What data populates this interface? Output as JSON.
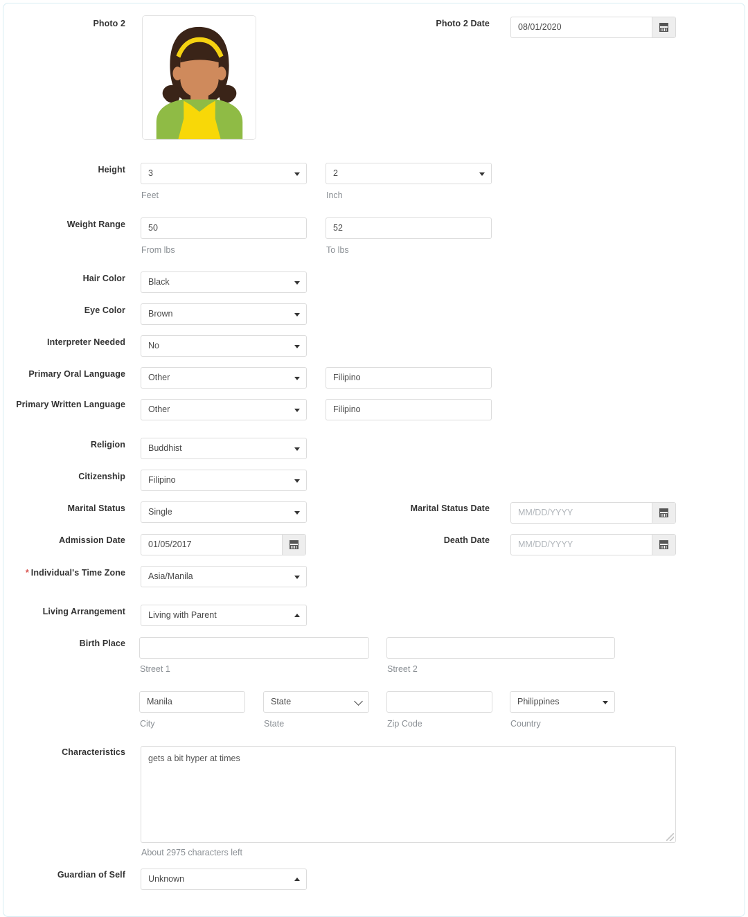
{
  "form": {
    "photo": {
      "label": "Photo 2",
      "alt": "girl-avatar",
      "date_label": "Photo 2 Date",
      "date_value": "08/01/2020",
      "colors": {
        "hair": "#3a2418",
        "headband": "#f5d211",
        "skin": "#cf8a5c",
        "shirt": "#8fbb45",
        "overalls": "#f8d808"
      }
    },
    "height": {
      "label": "Height",
      "feet_value": "3",
      "feet_helper": "Feet",
      "inch_value": "2",
      "inch_helper": "Inch"
    },
    "weight": {
      "label": "Weight Range",
      "from_value": "50",
      "from_helper": "From lbs",
      "to_value": "52",
      "to_helper": "To lbs"
    },
    "hair_color": {
      "label": "Hair Color",
      "value": "Black"
    },
    "eye_color": {
      "label": "Eye Color",
      "value": "Brown"
    },
    "interpreter": {
      "label": "Interpreter Needed",
      "value": "No"
    },
    "oral_language": {
      "label": "Primary Oral Language",
      "value": "Other",
      "other_value": "Filipino"
    },
    "written_language": {
      "label": "Primary Written Language",
      "value": "Other",
      "other_value": "Filipino"
    },
    "religion": {
      "label": "Religion",
      "value": "Buddhist"
    },
    "citizenship": {
      "label": "Citizenship",
      "value": "Filipino"
    },
    "marital_status": {
      "label": "Marital Status",
      "value": "Single"
    },
    "marital_status_date": {
      "label": "Marital Status Date",
      "value": "",
      "placeholder": "MM/DD/YYYY"
    },
    "admission_date": {
      "label": "Admission Date",
      "value": "01/05/2017"
    },
    "death_date": {
      "label": "Death Date",
      "value": "",
      "placeholder": "MM/DD/YYYY"
    },
    "time_zone": {
      "label": "Individual's Time Zone",
      "required_marker": "*",
      "value": "Asia/Manila"
    },
    "living_arrangement": {
      "label": "Living Arrangement",
      "value": "Living with Parent"
    },
    "birth_place": {
      "label": "Birth Place",
      "street1_value": "",
      "street1_helper": "Street 1",
      "street2_value": "",
      "street2_helper": "Street 2",
      "city_value": "Manila",
      "city_helper": "City",
      "state_value": "State",
      "state_helper": "State",
      "zip_value": "",
      "zip_helper": "Zip Code",
      "country_value": "Philippines",
      "country_helper": "Country"
    },
    "characteristics": {
      "label": "Characteristics",
      "value": "gets a bit hyper at times",
      "counter": "About 2975 characters left"
    },
    "guardian_of_self": {
      "label": "Guardian of Self",
      "value": "Unknown"
    }
  },
  "theme": {
    "panel_border": "#d6ecf3",
    "label_color": "#333333",
    "helper_color": "#8a8f94",
    "required_color": "#d9534f",
    "field_border": "#dcdcdc"
  }
}
